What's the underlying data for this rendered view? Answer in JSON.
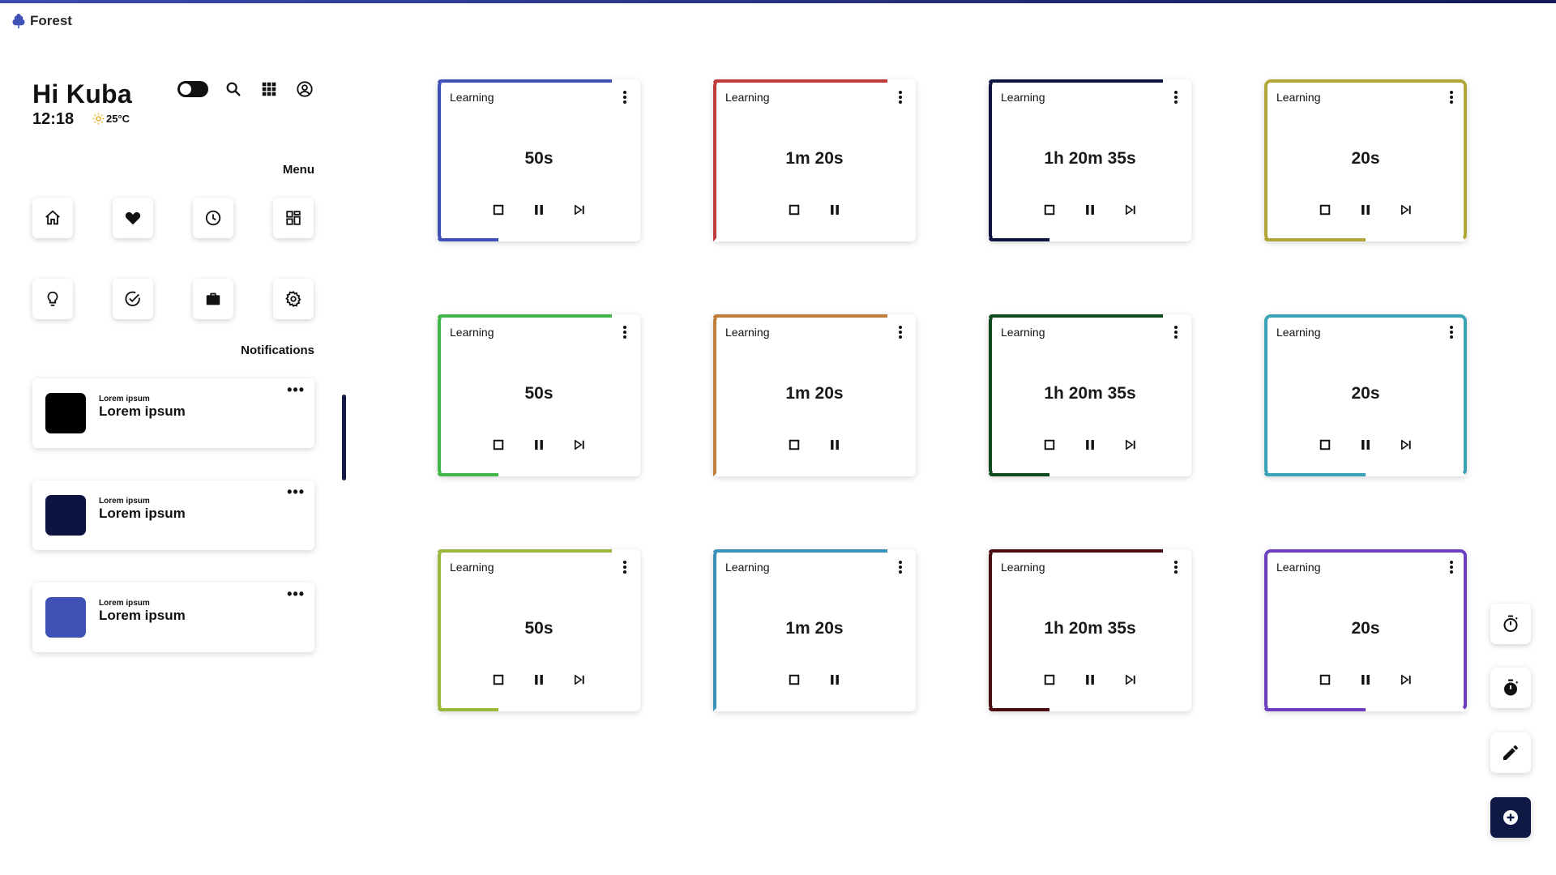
{
  "app": {
    "brand": "Forest",
    "accent": "#3b4bb0"
  },
  "header": {
    "greeting": "Hi Kuba",
    "time": "12:18",
    "temperature": "25°C",
    "icons": [
      "theme-toggle",
      "search-icon",
      "apps-grid-icon",
      "account-icon"
    ]
  },
  "menu": {
    "title": "Menu",
    "items": [
      "home-icon",
      "heart-icon",
      "clock-icon",
      "dashboard-icon",
      "lightbulb-icon",
      "check-circle-icon",
      "briefcase-icon",
      "settings-icon"
    ]
  },
  "notifications": {
    "title": "Notifications",
    "items": [
      {
        "small": "Lorem ipsum",
        "title": "Lorem ipsum",
        "color": "#000000"
      },
      {
        "small": "Lorem ipsum",
        "title": "Lorem ipsum",
        "color": "#0d1440"
      },
      {
        "small": "Lorem ipsum",
        "title": "Lorem ipsum",
        "color": "#3f51b5"
      }
    ]
  },
  "timers": [
    {
      "category": "Learning",
      "time": "50s",
      "color": "#3f51b5",
      "progress": 0.3,
      "skip": true
    },
    {
      "category": "Learning",
      "time": "1m 20s",
      "color": "#c0393b",
      "progress": 0.0,
      "skip": false
    },
    {
      "category": "Learning",
      "time": "1h 20m 35s",
      "color": "#0d1440",
      "progress": 0.3,
      "skip": true
    },
    {
      "category": "Learning",
      "time": "20s",
      "color": "#b0a63a",
      "progress": 0.5,
      "skip": true
    },
    {
      "category": "Learning",
      "time": "50s",
      "color": "#44b549",
      "progress": 0.3,
      "skip": true
    },
    {
      "category": "Learning",
      "time": "1m 20s",
      "color": "#c17d3a",
      "progress": 0.0,
      "skip": false
    },
    {
      "category": "Learning",
      "time": "1h 20m 35s",
      "color": "#0f4a1f",
      "progress": 0.3,
      "skip": true
    },
    {
      "category": "Learning",
      "time": "20s",
      "color": "#3aa3b5",
      "progress": 0.5,
      "skip": true
    },
    {
      "category": "Learning",
      "time": "50s",
      "color": "#9cb83c",
      "progress": 0.3,
      "skip": true
    },
    {
      "category": "Learning",
      "time": "1m 20s",
      "color": "#3b91b7",
      "progress": 0.0,
      "skip": false
    },
    {
      "category": "Learning",
      "time": "1h 20m 35s",
      "color": "#4a0d12",
      "progress": 0.3,
      "skip": true
    },
    {
      "category": "Learning",
      "time": "20s",
      "color": "#6b3fbd",
      "progress": 0.5,
      "skip": true
    }
  ],
  "actions": [
    "stopwatch-icon",
    "timer-icon",
    "edit-icon",
    "add-icon"
  ]
}
